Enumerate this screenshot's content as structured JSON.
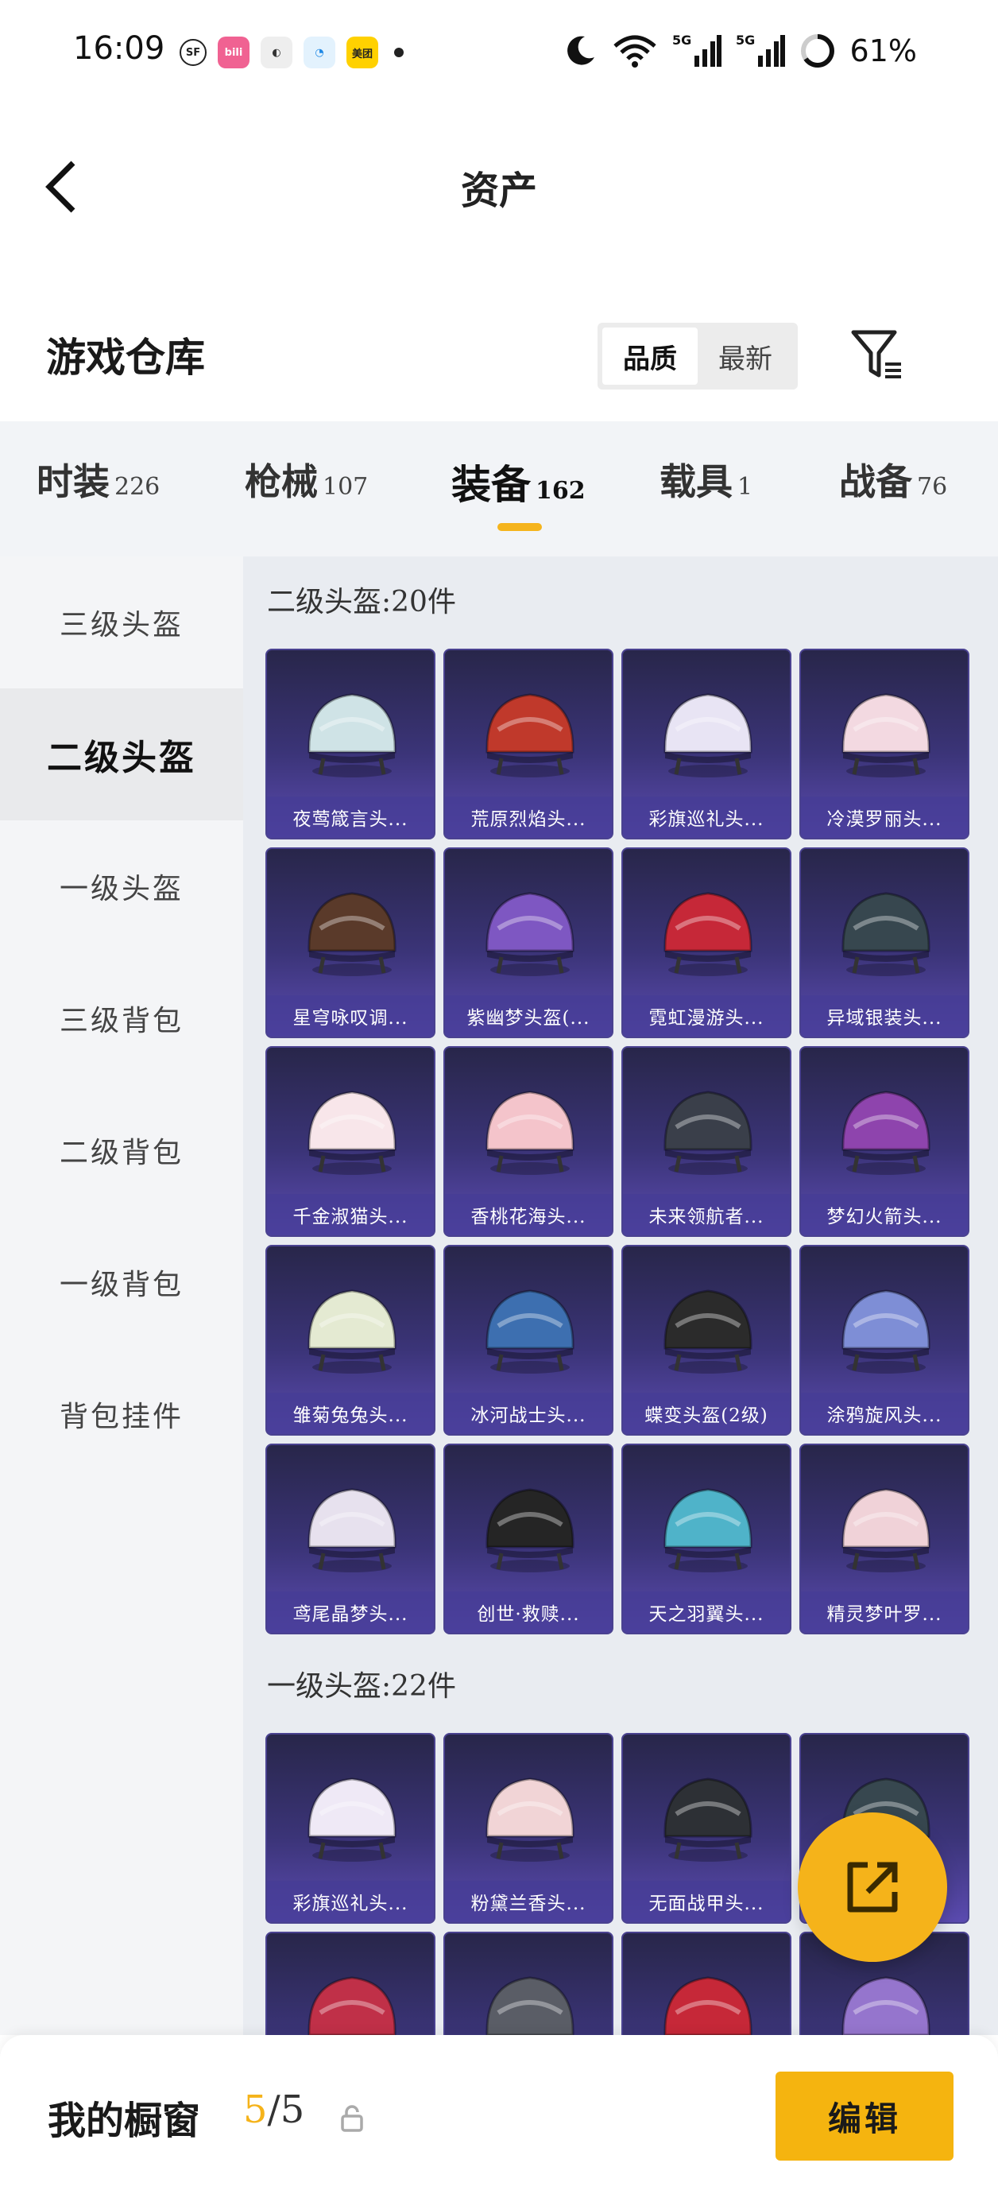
{
  "status_bar": {
    "time": "16:09",
    "app_icons": [
      {
        "name": "sf-express-icon",
        "label": "SF",
        "color": "#ffffff"
      },
      {
        "name": "bilibili-icon",
        "label": "bili",
        "color": "#f06292"
      },
      {
        "name": "app-icon",
        "label": "",
        "color": "#eeeeee"
      },
      {
        "name": "app-icon-blue",
        "label": "",
        "color": "#e3f2fd"
      },
      {
        "name": "meituan-icon",
        "label": "美团",
        "color": "#ffd100"
      }
    ],
    "network_labels": [
      "5G",
      "5G"
    ],
    "battery": "61%"
  },
  "header": {
    "title": "资产"
  },
  "warehouse": {
    "title": "游戏仓库",
    "sort_options": [
      "品质",
      "最新"
    ],
    "sort_selected": "品质"
  },
  "tabs": [
    {
      "label": "时装",
      "count": "226"
    },
    {
      "label": "枪械",
      "count": "107"
    },
    {
      "label": "装备",
      "count": "162",
      "active": true
    },
    {
      "label": "载具",
      "count": "1"
    },
    {
      "label": "战备",
      "count": "76"
    }
  ],
  "sidebar": [
    {
      "label": "三级头盔"
    },
    {
      "label": "二级头盔",
      "active": true
    },
    {
      "label": "一级头盔"
    },
    {
      "label": "三级背包"
    },
    {
      "label": "二级背包"
    },
    {
      "label": "一级背包"
    },
    {
      "label": "背包挂件"
    }
  ],
  "sections": [
    {
      "title": "二级头盔:20件",
      "items": [
        {
          "name": "夜莺箴言头...",
          "color": "#cfe3e6"
        },
        {
          "name": "荒原烈焰头...",
          "color": "#c0392b"
        },
        {
          "name": "彩旗巡礼头...",
          "color": "#e8e4f4"
        },
        {
          "name": "冷漠罗丽头...",
          "color": "#f3d9e1"
        },
        {
          "name": "星穹咏叹调...",
          "color": "#5a3a2a"
        },
        {
          "name": "紫幽梦头盔(...",
          "color": "#7e57c2"
        },
        {
          "name": "霓虹漫游头...",
          "color": "#c62838"
        },
        {
          "name": "异域银装头...",
          "color": "#37474f"
        },
        {
          "name": "千金淑猫头...",
          "color": "#f8e6ea"
        },
        {
          "name": "香桃花海头...",
          "color": "#f4c4cb"
        },
        {
          "name": "未来领航者...",
          "color": "#3a3f4a"
        },
        {
          "name": "梦幻火箭头...",
          "color": "#8e44ad"
        },
        {
          "name": "雏菊兔兔头...",
          "color": "#e4ead2"
        },
        {
          "name": "冰河战士头...",
          "color": "#3d6fb0"
        },
        {
          "name": "蝶变头盔(2级)",
          "color": "#2b2b2b"
        },
        {
          "name": "涂鸦旋风头...",
          "color": "#7e8ed6"
        },
        {
          "name": "鸢尾晶梦头...",
          "color": "#e7e1ee"
        },
        {
          "name": "创世·救赎...",
          "color": "#252525"
        },
        {
          "name": "天之羽翼头...",
          "color": "#4fb3c9"
        },
        {
          "name": "精灵梦叶罗...",
          "color": "#f0d2d8"
        }
      ]
    },
    {
      "title": "一级头盔:22件",
      "items": [
        {
          "name": "彩旗巡礼头...",
          "color": "#efe9f6"
        },
        {
          "name": "粉黛兰香头...",
          "color": "#f1d4d6"
        },
        {
          "name": "无面战甲头...",
          "color": "#2d3035"
        },
        {
          "name": "",
          "color": "#37474f"
        },
        {
          "name": "",
          "color": "#c03048"
        },
        {
          "name": "",
          "color": "#5a5d66"
        },
        {
          "name": "",
          "color": "#c62838"
        },
        {
          "name": "",
          "color": "#9575cd"
        }
      ]
    }
  ],
  "bottom_bar": {
    "label": "我的橱窗",
    "current": "5",
    "total": "/5",
    "edit_label": "编辑"
  }
}
